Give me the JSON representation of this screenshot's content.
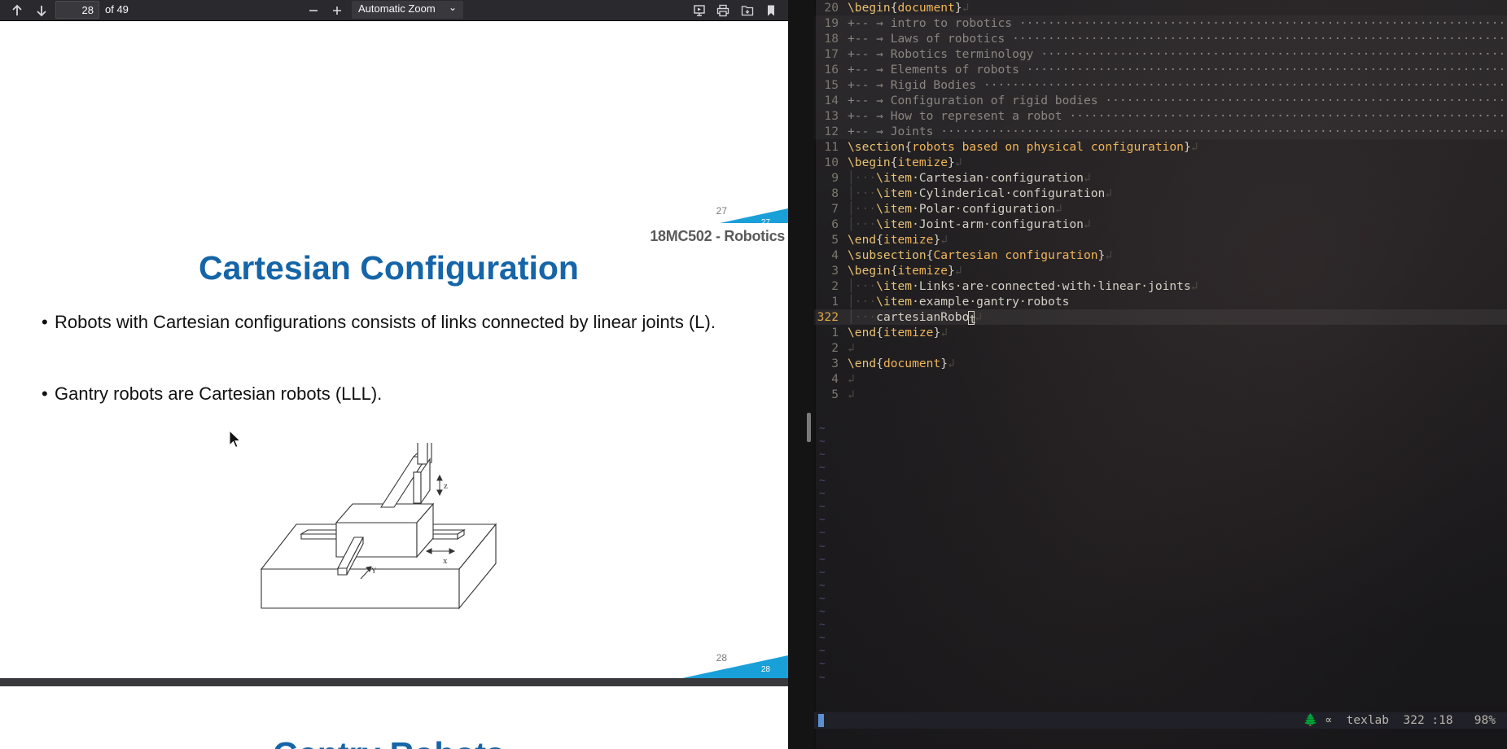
{
  "pdf_toolbar": {
    "page_value": "28",
    "page_total": "of 49",
    "zoom_label": "Automatic Zoom"
  },
  "pages": {
    "page27": {
      "page_number": "27",
      "corner_number": "27"
    },
    "page28": {
      "course_code": "18MC502 - Robotics",
      "title": "Cartesian Configuration",
      "bullets": [
        "Robots with Cartesian configurations consists of links connected by linear joints (L).",
        "Gantry robots are Cartesian robots (LLL)."
      ],
      "figure_labels": {
        "z": "z",
        "x": "x",
        "y": "Y"
      },
      "page_number": "28",
      "corner_number": "28"
    },
    "page29": {
      "title_partial": "Gantry Robots"
    }
  },
  "editor": {
    "lines": [
      {
        "ln": "20",
        "kind": "env",
        "cmd": "\\begin",
        "arg": "document",
        "eol": "↲"
      },
      {
        "ln": "19",
        "kind": "fold",
        "text": "+-- → intro to robotics ·················································································"
      },
      {
        "ln": "18",
        "kind": "fold",
        "text": "+-- → Laws of robotics ···················································································"
      },
      {
        "ln": "17",
        "kind": "fold",
        "text": "+-- → Robotics terminology ···············································································"
      },
      {
        "ln": "16",
        "kind": "fold",
        "text": "+-- → Elements of robots ·················································································"
      },
      {
        "ln": "15",
        "kind": "fold",
        "text": "+-- → Rigid Bodies ·······················································································"
      },
      {
        "ln": "14",
        "kind": "fold",
        "text": "+-- → Configuration of rigid bodies ······································································"
      },
      {
        "ln": "13",
        "kind": "fold",
        "text": "+-- → How to represent a robot ···········································································"
      },
      {
        "ln": "12",
        "kind": "fold",
        "text": "+-- → Joints ·····························································································"
      },
      {
        "ln": "11",
        "kind": "env",
        "cmd": "\\section",
        "arg": "robots based on physical configuration",
        "eol": "↲"
      },
      {
        "ln": "10",
        "kind": "env",
        "cmd": "\\begin",
        "arg": "itemize",
        "eol": "↲"
      },
      {
        "ln": "9",
        "kind": "item",
        "indent": "│···",
        "cmd": "\\item",
        "text": "·Cartesian·configuration",
        "eol": "↲"
      },
      {
        "ln": "8",
        "kind": "item",
        "indent": "│···",
        "cmd": "\\item",
        "text": "·Cylinderical·configuration",
        "eol": "↲"
      },
      {
        "ln": "7",
        "kind": "item",
        "indent": "│···",
        "cmd": "\\item",
        "text": "·Polar·configuration",
        "eol": "↲"
      },
      {
        "ln": "6",
        "kind": "item",
        "indent": "│···",
        "cmd": "\\item",
        "text": "·Joint-arm·configuration",
        "eol": "↲"
      },
      {
        "ln": "5",
        "kind": "env",
        "cmd": "\\end",
        "arg": "itemize",
        "eol": "↲"
      },
      {
        "ln": "4",
        "kind": "env",
        "cmd": "\\subsection",
        "arg": "Cartesian configuration",
        "eol": "↲"
      },
      {
        "ln": "3",
        "kind": "env",
        "cmd": "\\begin",
        "arg": "itemize",
        "eol": "↲"
      },
      {
        "ln": "2",
        "kind": "item",
        "indent": "│···",
        "cmd": "\\item",
        "text": "·Links·are·connected·with·linear·joints",
        "eol": "↲"
      },
      {
        "ln": "1",
        "kind": "item",
        "indent": "│···",
        "cmd": "\\item",
        "text": "·example·gantry·robots",
        "eol": ""
      },
      {
        "ln": "322",
        "kind": "current",
        "indent": "│···",
        "text": "cartesianRobo",
        "cursor_char": "t",
        "eol": "↲"
      },
      {
        "ln": "1",
        "kind": "env",
        "cmd": "\\end",
        "arg": "itemize",
        "eol": "↲"
      },
      {
        "ln": "2",
        "kind": "blank",
        "eol": "↲"
      },
      {
        "ln": "3",
        "kind": "env",
        "cmd": "\\end",
        "arg": "document",
        "eol": "↲"
      },
      {
        "ln": "4",
        "kind": "blank",
        "eol": "↲"
      },
      {
        "ln": "5",
        "kind": "blank",
        "eol": "↲"
      }
    ],
    "tilde_char": "~",
    "tilde_count": 20
  },
  "statusline": {
    "tree_icon": "🌲",
    "infinity_icon": "∝",
    "lsp": "texlab",
    "position": "322 :18",
    "percent": "98%"
  },
  "colors": {
    "title_blue": "#1565a8",
    "corner_cyan": "#1aa0d8",
    "editor_keyword": "#e6c073",
    "status_mode": "#5b8ed2"
  }
}
